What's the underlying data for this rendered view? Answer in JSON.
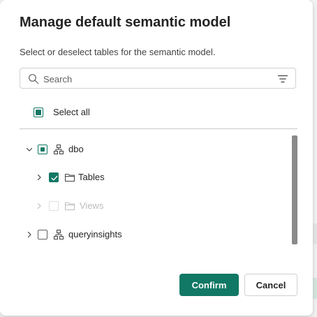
{
  "dialog": {
    "title": "Manage default semantic model",
    "subtitle": "Select or deselect tables for the semantic model."
  },
  "search": {
    "placeholder": "Search",
    "value": "",
    "icon": "search-icon",
    "filter_icon": "filter-icon"
  },
  "select_all": {
    "label": "Select all",
    "state": "mixed"
  },
  "tree": [
    {
      "label": "dbo",
      "icon": "schema-icon",
      "expanded": true,
      "state": "mixed",
      "children": [
        {
          "label": "Tables",
          "icon": "folder-icon",
          "expanded": false,
          "state": "checked",
          "disabled": false
        },
        {
          "label": "Views",
          "icon": "folder-icon",
          "expanded": false,
          "state": "unchecked",
          "disabled": true
        }
      ]
    },
    {
      "label": "queryinsights",
      "icon": "schema-icon",
      "expanded": false,
      "state": "unchecked"
    }
  ],
  "buttons": {
    "confirm": "Confirm",
    "cancel": "Cancel"
  },
  "colors": {
    "accent": "#117865",
    "text": "#242424",
    "muted": "#616161",
    "disabled": "#bdbdbd"
  }
}
